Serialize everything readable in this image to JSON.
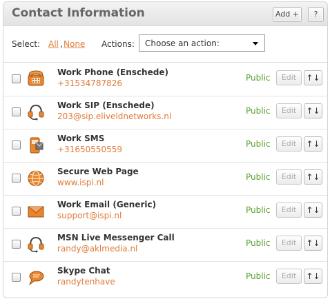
{
  "header": {
    "title": "Contact Information",
    "add_label": "Add +",
    "help_label": "?"
  },
  "selectbar": {
    "select_label": "Select:",
    "all_label": "All",
    "comma": ",",
    "none_label": "None",
    "actions_label": "Actions:",
    "action_selected": "Choose an action:"
  },
  "rows": [
    {
      "name": "Work Phone (Enschede)",
      "value": "+31534787826",
      "visibility": "Public",
      "edit_label": "Edit",
      "sort_label": "↑↓",
      "icon": "phone-icon"
    },
    {
      "name": "Work SIP (Enschede)",
      "value": "203@sip.eliveldnetworks.nl",
      "visibility": "Public",
      "edit_label": "Edit",
      "sort_label": "↑↓",
      "icon": "headset-icon"
    },
    {
      "name": "Work SMS",
      "value": "+31650550559",
      "visibility": "Public",
      "edit_label": "Edit",
      "sort_label": "↑↓",
      "icon": "mobile-phone-icon"
    },
    {
      "name": "Secure Web Page",
      "value": "www.ispi.nl",
      "visibility": "Public",
      "edit_label": "Edit",
      "sort_label": "↑↓",
      "icon": "globe-icon"
    },
    {
      "name": "Work Email (Generic)",
      "value": "support@ispi.nl",
      "visibility": "Public",
      "edit_label": "Edit",
      "sort_label": "↑↓",
      "icon": "envelope-icon"
    },
    {
      "name": "MSN Live Messenger Call",
      "value": "randy@aklmedia.nl",
      "visibility": "Public",
      "edit_label": "Edit",
      "sort_label": "↑↓",
      "icon": "headset-icon"
    },
    {
      "name": "Skype Chat",
      "value": "randytenhave",
      "visibility": "Public",
      "edit_label": "Edit",
      "sort_label": "↑↓",
      "icon": "chat-bubble-icon"
    }
  ],
  "colors": {
    "accent": "#e07b39",
    "public": "#5aa02c",
    "title": "#666666"
  }
}
